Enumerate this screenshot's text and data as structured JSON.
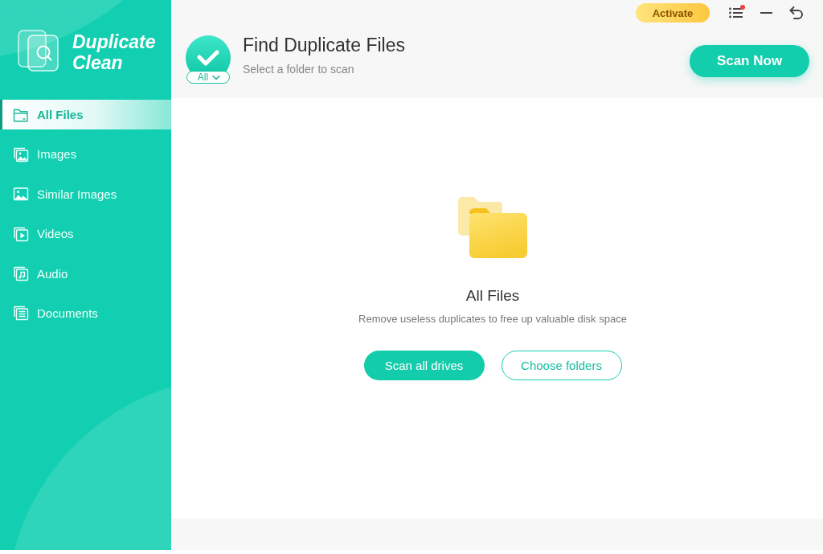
{
  "logo": {
    "name": "Duplicate Clean"
  },
  "sidebar": {
    "items": [
      {
        "label": "All Files",
        "selected": true
      },
      {
        "label": "Images",
        "selected": false
      },
      {
        "label": "Similar Images",
        "selected": false
      },
      {
        "label": "Videos",
        "selected": false
      },
      {
        "label": "Audio",
        "selected": false
      },
      {
        "label": "Documents",
        "selected": false
      }
    ]
  },
  "top_bar": {
    "activate_button": "Activate",
    "menu_notification": true
  },
  "header": {
    "title": "Find Duplicate Files",
    "subtitle": "Select a folder to scan",
    "filter": {
      "value": "All"
    },
    "scan_button": "Scan Now"
  },
  "content": {
    "title": "All Files",
    "description": "Remove useless duplicates to free up valuable disk space",
    "buttons": [
      {
        "label": "Scan all drives",
        "kind": "primary"
      },
      {
        "label": "Choose folders",
        "kind": "outline"
      }
    ]
  }
}
